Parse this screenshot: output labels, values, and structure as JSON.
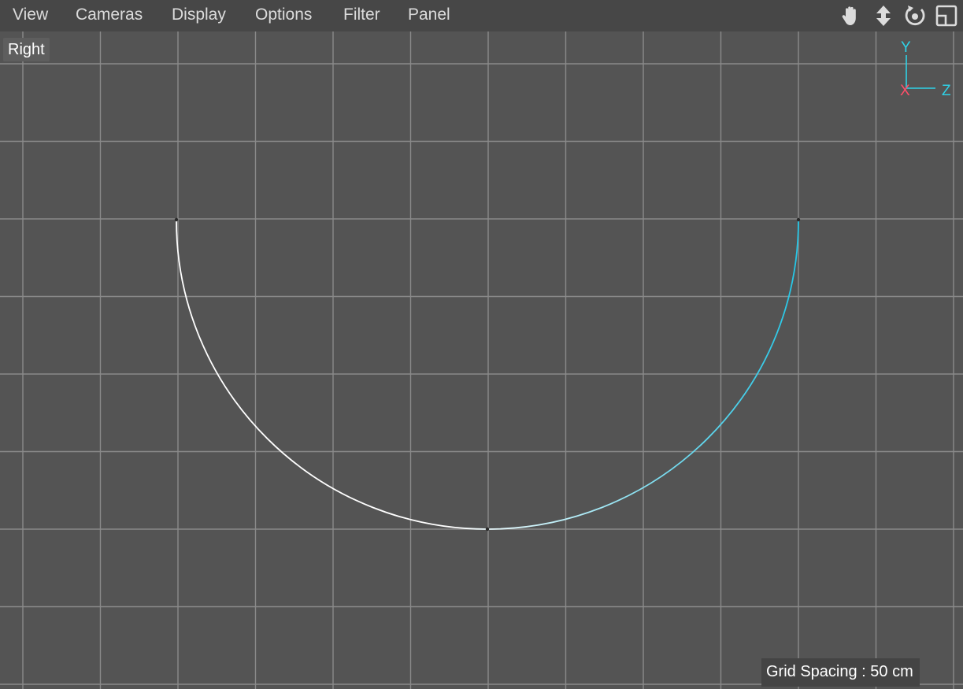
{
  "menu": [
    "View",
    "Cameras",
    "Display",
    "Options",
    "Filter",
    "Panel"
  ],
  "nav_icons": {
    "move": "hand-icon",
    "zoom": "zoom-arrows-icon",
    "rotate": "orbit-icon",
    "toggle": "panel-toggle-icon"
  },
  "viewport": {
    "label": "Right",
    "grid_spacing": "Grid Spacing : 50 cm"
  },
  "axis": {
    "y_label": "Y",
    "x_label": "X",
    "z_label": "Z",
    "y_color": "#2fd1e6",
    "x_color": "#ff4f6a",
    "z_color": "#2fd1e6"
  },
  "colors": {
    "background": "#545454",
    "grid_major": "#8a8a8a",
    "spline_start": "#ffffff",
    "spline_end": "#24c6e6"
  }
}
